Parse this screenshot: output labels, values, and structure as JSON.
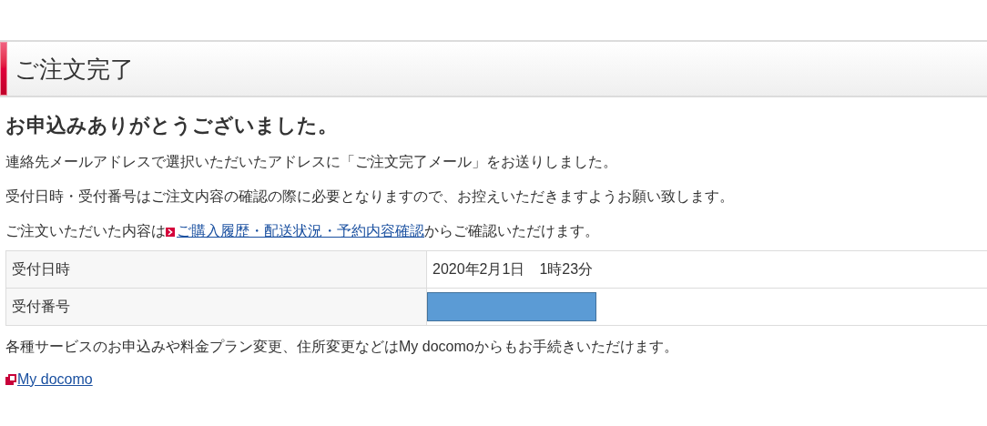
{
  "page_title": "ご注文完了",
  "heading": "お申込みありがとうございました。",
  "paragraphs": [
    "連絡先メールアドレスで選択いただいたアドレスに「ご注文完了メール」をお送りしました。",
    "受付日時・受付番号はご注文内容の確認の際に必要となりますので、お控えいただきますようお願い致します。"
  ],
  "link_sentence": {
    "before": "ご注文いただいた内容は",
    "link": "ご購入履歴・配送状況・予約内容確認",
    "after": "からご確認いただけます。"
  },
  "table": {
    "rows": [
      {
        "label": "受付日時",
        "kind": "text",
        "value": "2020年2月1日　1時23分"
      },
      {
        "label": "受付番号",
        "kind": "redacted"
      }
    ]
  },
  "note": "各種サービスのお申込みや料金プラン変更、住所変更などはMy docomoからもお手続きいただけます。",
  "external_link": "My docomo"
}
